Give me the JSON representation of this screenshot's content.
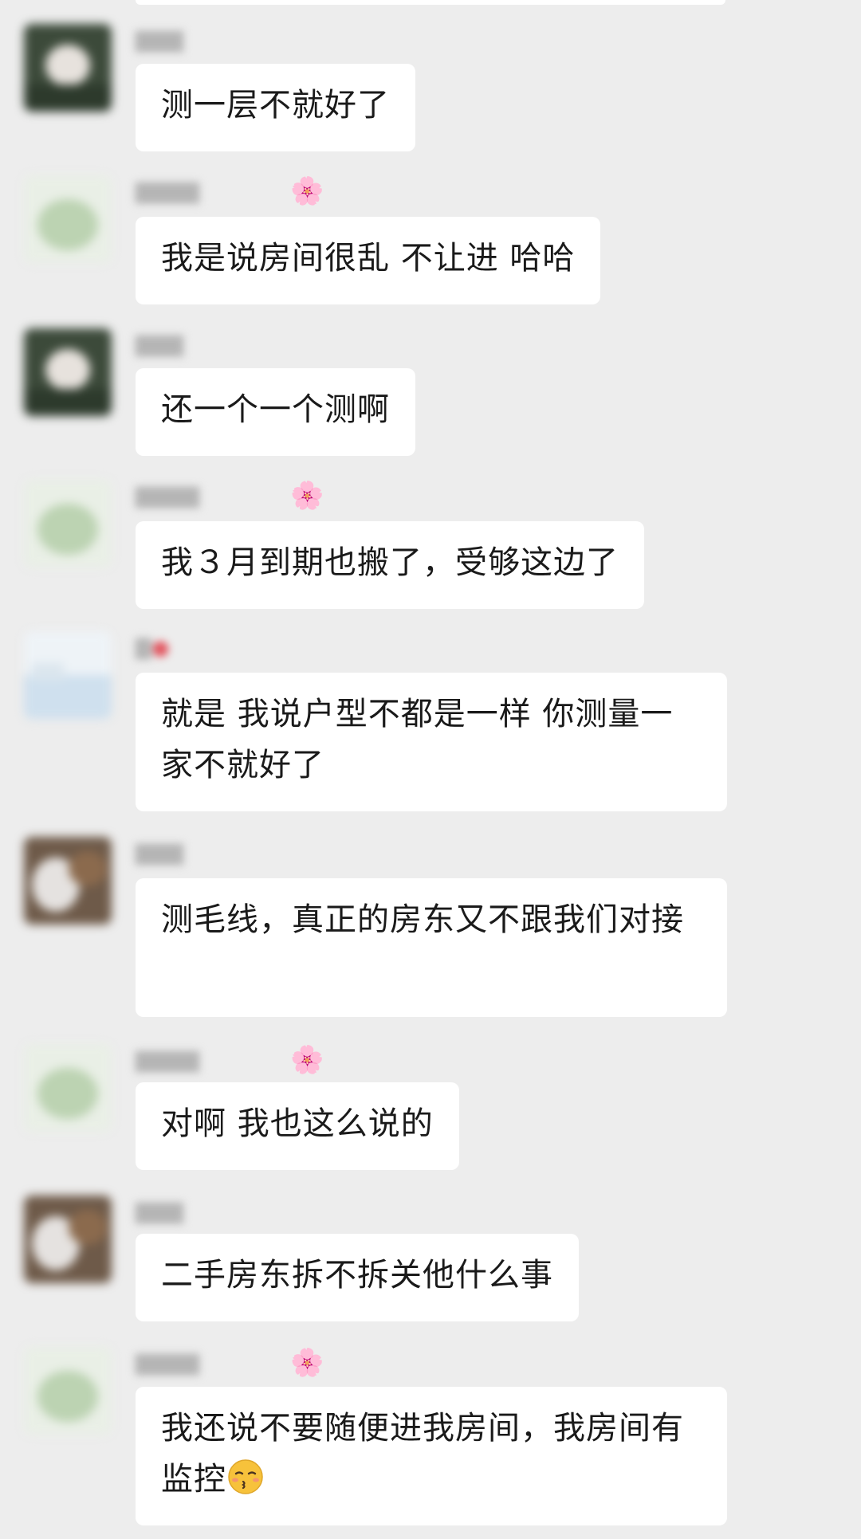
{
  "messages": [
    {
      "sender": "A",
      "text": "测一层不就好了",
      "nick_emoji": ""
    },
    {
      "sender": "B",
      "text": "我是说房间很乱 不让进 哈哈",
      "nick_emoji": "🌸"
    },
    {
      "sender": "A",
      "text": "还一个一个测啊",
      "nick_emoji": ""
    },
    {
      "sender": "B",
      "text": "我３月到期也搬了，受够这边了",
      "nick_emoji": "🌸"
    },
    {
      "sender": "C",
      "text": "就是 我说户型不都是一样 你测量一家不就好了",
      "nick_emoji": ""
    },
    {
      "sender": "D",
      "text": "测毛线，真正的房东又不跟我们对接",
      "nick_emoji": ""
    },
    {
      "sender": "B",
      "text": "对啊 我也这么说的",
      "nick_emoji": "🌸"
    },
    {
      "sender": "D",
      "text": "二手房东拆不拆关他什么事",
      "nick_emoji": ""
    },
    {
      "sender": "B",
      "text": "我还说不要随便进我房间，我房间有监控",
      "nick_emoji": "🌸",
      "trailing_icon": "kissing-face-closed-eyes-icon"
    }
  ],
  "colors": {
    "background": "#ededed",
    "bubble": "#ffffff",
    "text": "#1a1a1a"
  }
}
